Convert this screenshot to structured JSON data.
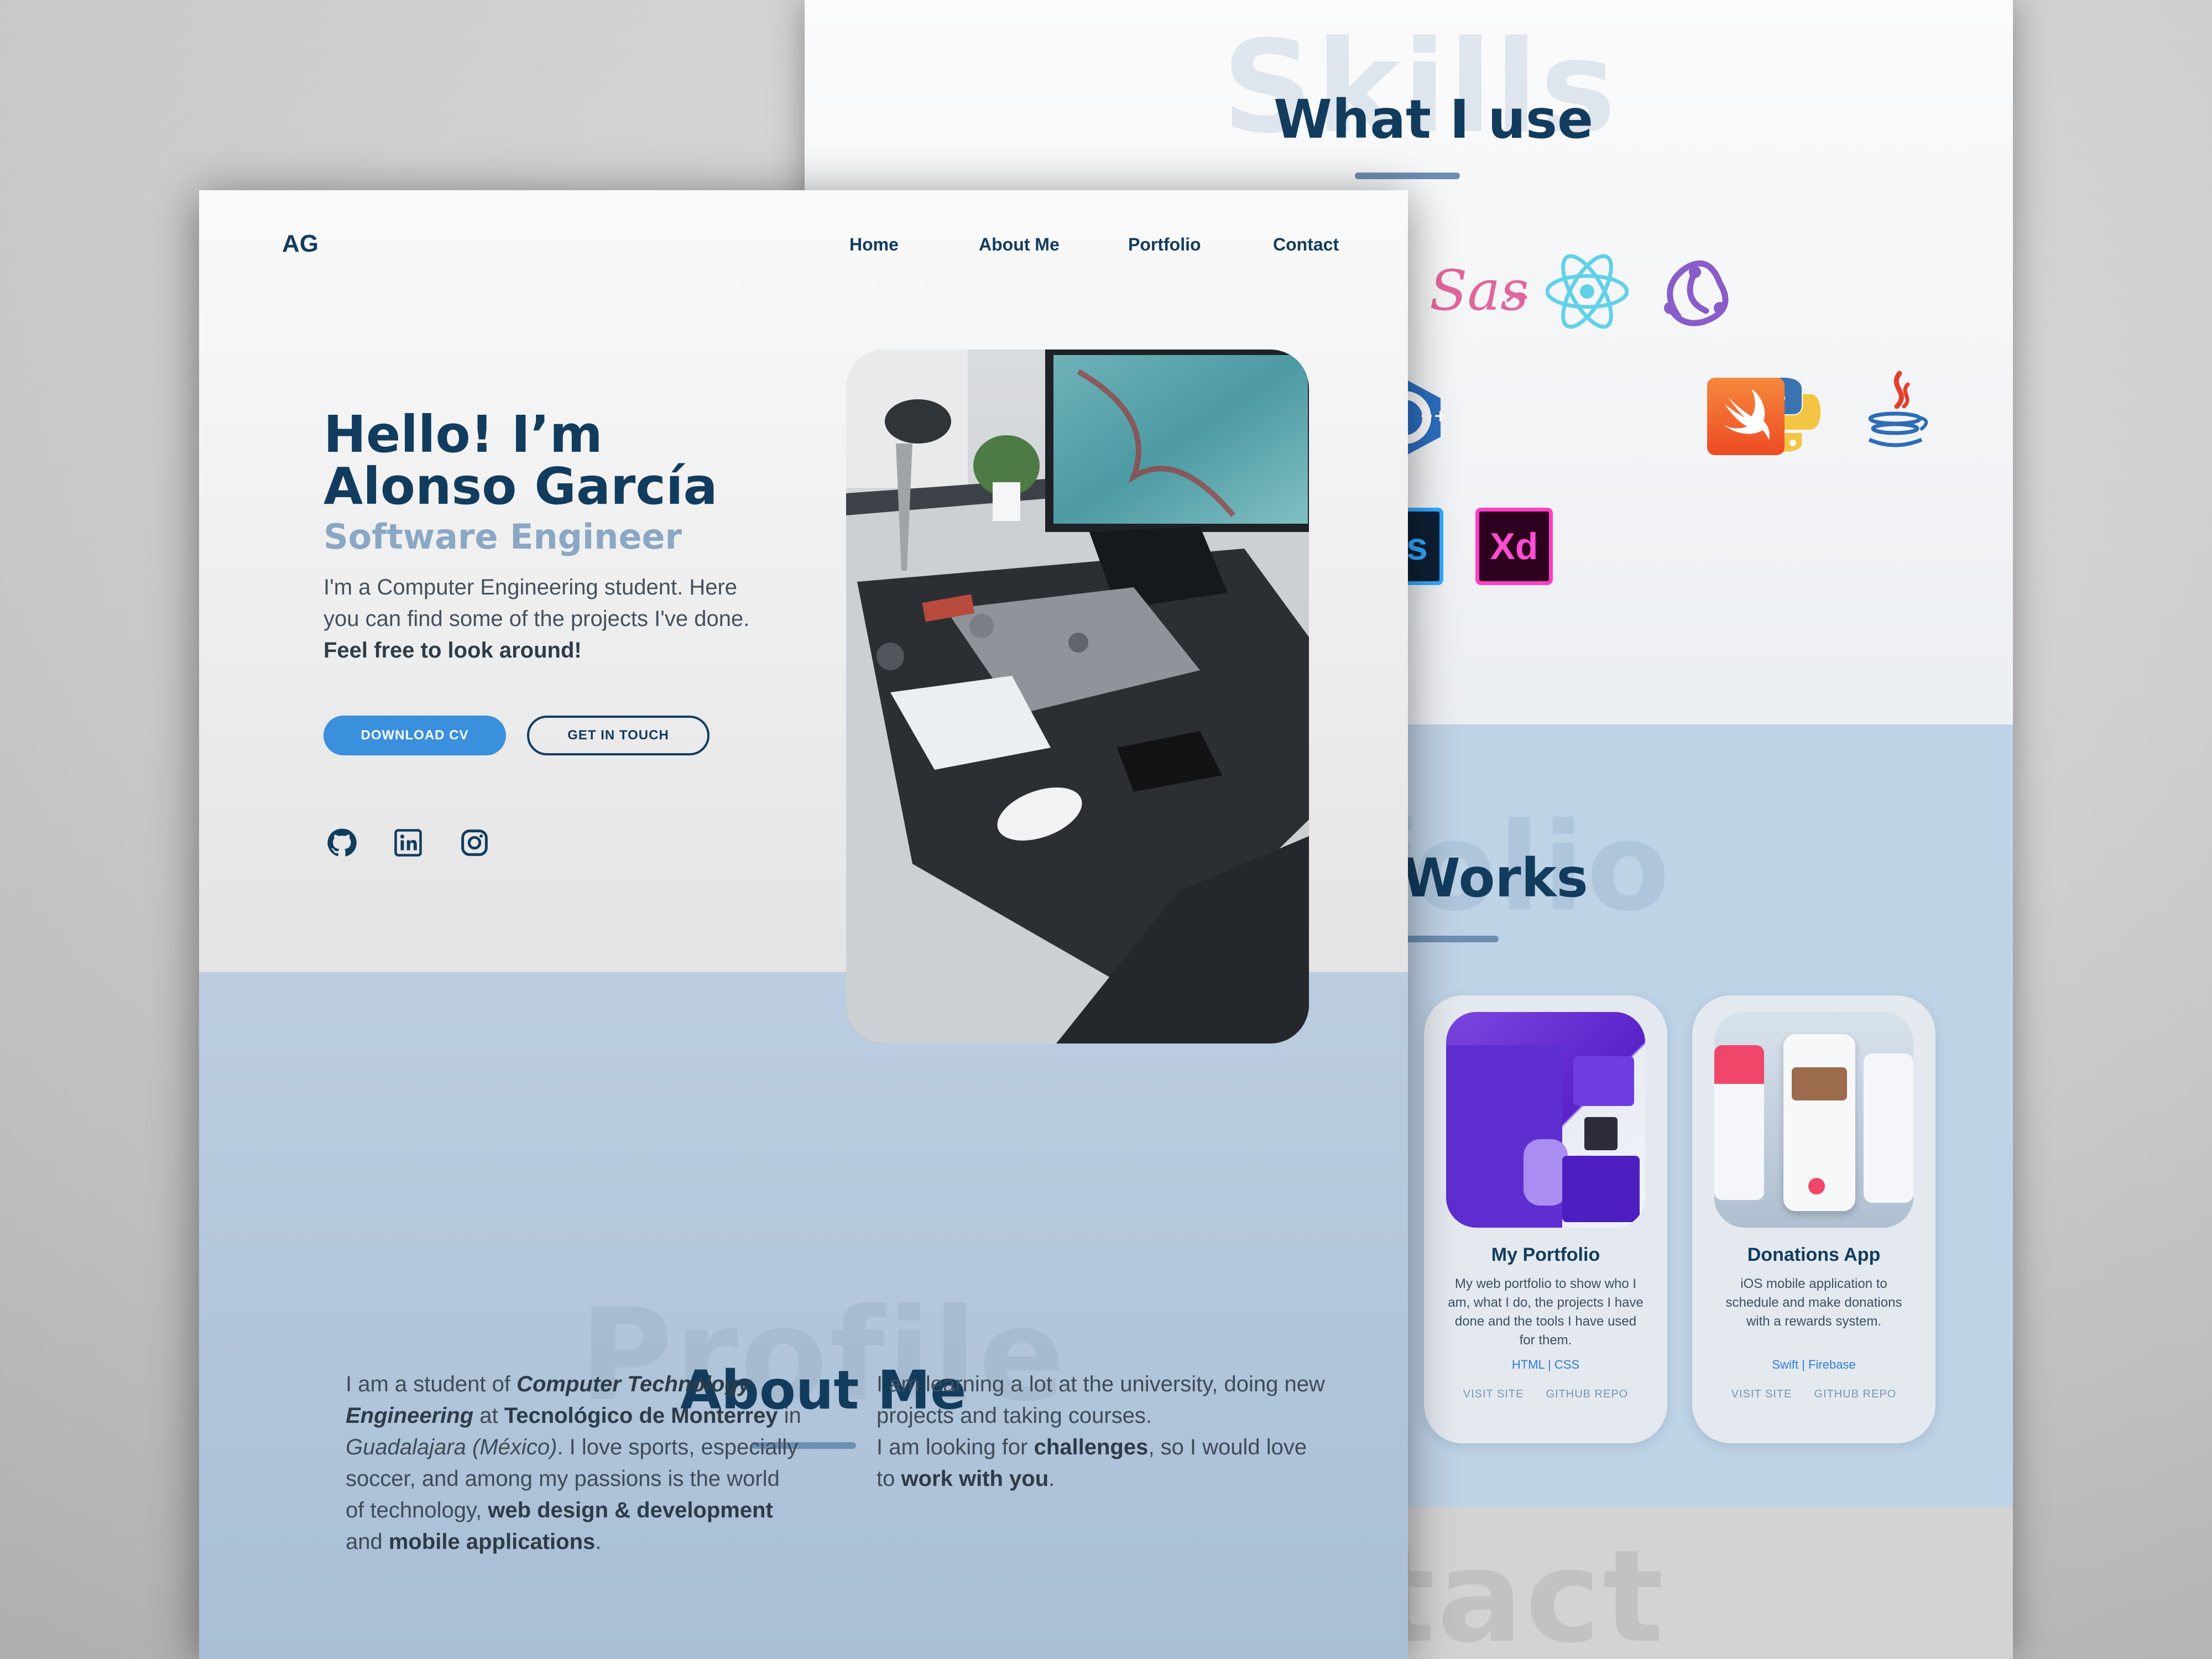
{
  "back_page": {
    "skills": {
      "ghost_title": "Skills",
      "title": "What I use",
      "icons": [
        "sass-icon",
        "react-icon",
        "redux-icon",
        "cplusplus-icon",
        "python-icon",
        "java-icon",
        "swift-icon",
        "photoshop-icon",
        "xd-icon"
      ],
      "xd_label": "Xd",
      "ps_label": "s",
      "sass_label": "Sass"
    },
    "portfolio": {
      "ghost_title": "folio",
      "title": "Works",
      "cards": [
        {
          "title": "My Portfolio",
          "description": "My web portfolio to show who I am, what I do, the projects I have done and the tools I have used for them.",
          "tags": "HTML | CSS",
          "visit": "VISIT SITE",
          "repo": "GITHUB REPO"
        },
        {
          "title": "Donations App",
          "description": "iOS mobile application to schedule and make donations with a rewards system.",
          "tags": "Swift | Firebase",
          "visit": "VISIT SITE",
          "repo": "GITHUB REPO"
        }
      ]
    },
    "contact": {
      "ghost_title": "tact"
    }
  },
  "front_page": {
    "logo": "AG",
    "nav": [
      "Home",
      "About Me",
      "Portfolio",
      "Contact"
    ],
    "hero": {
      "greeting_line1": "Hello! I’m",
      "greeting_line2": "Alonso García",
      "role": "Software Engineer",
      "intro_line1": "I'm a Computer Engineering student. Here",
      "intro_line2": "you can find some of the projects I've done.",
      "intro_bold": "Feel free to look around!",
      "download_cv": "DOWNLOAD CV",
      "get_in_touch": "GET IN TOUCH",
      "social_icons": [
        "github-icon",
        "linkedin-icon",
        "instagram-icon"
      ]
    },
    "about": {
      "ghost_title": "Profile",
      "title": "About Me",
      "col1": {
        "t1": "I am a student of ",
        "b1": "Computer Technology Engineering",
        "t2": " at ",
        "b2": "Tecnológico de Monterrey",
        "t3": " in ",
        "i1": "Guadalajara (México)",
        "t4": ". I love sports, especially soccer, and among my passions is the world of technology, ",
        "b3": "web design & development",
        "t5": " and ",
        "b4": "mobile applications",
        "t6": "."
      },
      "col2": {
        "t1": "I am learning a lot at the university, doing new projects and taking courses.",
        "t2": "I am looking for ",
        "b1": "challenges",
        "t3": ", so I would love to ",
        "b2": "work with you",
        "t4": "."
      }
    }
  },
  "colors": {
    "navy": "#123c5e",
    "accent_blue": "#3a90dc",
    "muted_blue": "#8aa7c3",
    "section_blue": "#bccde0"
  }
}
